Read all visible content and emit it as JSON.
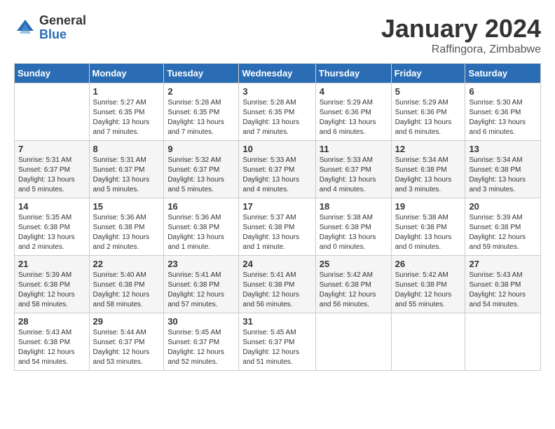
{
  "header": {
    "logo_general": "General",
    "logo_blue": "Blue",
    "month_title": "January 2024",
    "location": "Raffingora, Zimbabwe"
  },
  "days_of_week": [
    "Sunday",
    "Monday",
    "Tuesday",
    "Wednesday",
    "Thursday",
    "Friday",
    "Saturday"
  ],
  "weeks": [
    [
      {
        "day": "",
        "info": ""
      },
      {
        "day": "1",
        "info": "Sunrise: 5:27 AM\nSunset: 6:35 PM\nDaylight: 13 hours\nand 7 minutes."
      },
      {
        "day": "2",
        "info": "Sunrise: 5:28 AM\nSunset: 6:35 PM\nDaylight: 13 hours\nand 7 minutes."
      },
      {
        "day": "3",
        "info": "Sunrise: 5:28 AM\nSunset: 6:35 PM\nDaylight: 13 hours\nand 7 minutes."
      },
      {
        "day": "4",
        "info": "Sunrise: 5:29 AM\nSunset: 6:36 PM\nDaylight: 13 hours\nand 6 minutes."
      },
      {
        "day": "5",
        "info": "Sunrise: 5:29 AM\nSunset: 6:36 PM\nDaylight: 13 hours\nand 6 minutes."
      },
      {
        "day": "6",
        "info": "Sunrise: 5:30 AM\nSunset: 6:36 PM\nDaylight: 13 hours\nand 6 minutes."
      }
    ],
    [
      {
        "day": "7",
        "info": "Sunrise: 5:31 AM\nSunset: 6:37 PM\nDaylight: 13 hours\nand 5 minutes."
      },
      {
        "day": "8",
        "info": "Sunrise: 5:31 AM\nSunset: 6:37 PM\nDaylight: 13 hours\nand 5 minutes."
      },
      {
        "day": "9",
        "info": "Sunrise: 5:32 AM\nSunset: 6:37 PM\nDaylight: 13 hours\nand 5 minutes."
      },
      {
        "day": "10",
        "info": "Sunrise: 5:33 AM\nSunset: 6:37 PM\nDaylight: 13 hours\nand 4 minutes."
      },
      {
        "day": "11",
        "info": "Sunrise: 5:33 AM\nSunset: 6:37 PM\nDaylight: 13 hours\nand 4 minutes."
      },
      {
        "day": "12",
        "info": "Sunrise: 5:34 AM\nSunset: 6:38 PM\nDaylight: 13 hours\nand 3 minutes."
      },
      {
        "day": "13",
        "info": "Sunrise: 5:34 AM\nSunset: 6:38 PM\nDaylight: 13 hours\nand 3 minutes."
      }
    ],
    [
      {
        "day": "14",
        "info": "Sunrise: 5:35 AM\nSunset: 6:38 PM\nDaylight: 13 hours\nand 2 minutes."
      },
      {
        "day": "15",
        "info": "Sunrise: 5:36 AM\nSunset: 6:38 PM\nDaylight: 13 hours\nand 2 minutes."
      },
      {
        "day": "16",
        "info": "Sunrise: 5:36 AM\nSunset: 6:38 PM\nDaylight: 13 hours\nand 1 minute."
      },
      {
        "day": "17",
        "info": "Sunrise: 5:37 AM\nSunset: 6:38 PM\nDaylight: 13 hours\nand 1 minute."
      },
      {
        "day": "18",
        "info": "Sunrise: 5:38 AM\nSunset: 6:38 PM\nDaylight: 13 hours\nand 0 minutes."
      },
      {
        "day": "19",
        "info": "Sunrise: 5:38 AM\nSunset: 6:38 PM\nDaylight: 13 hours\nand 0 minutes."
      },
      {
        "day": "20",
        "info": "Sunrise: 5:39 AM\nSunset: 6:38 PM\nDaylight: 12 hours\nand 59 minutes."
      }
    ],
    [
      {
        "day": "21",
        "info": "Sunrise: 5:39 AM\nSunset: 6:38 PM\nDaylight: 12 hours\nand 58 minutes."
      },
      {
        "day": "22",
        "info": "Sunrise: 5:40 AM\nSunset: 6:38 PM\nDaylight: 12 hours\nand 58 minutes."
      },
      {
        "day": "23",
        "info": "Sunrise: 5:41 AM\nSunset: 6:38 PM\nDaylight: 12 hours\nand 57 minutes."
      },
      {
        "day": "24",
        "info": "Sunrise: 5:41 AM\nSunset: 6:38 PM\nDaylight: 12 hours\nand 56 minutes."
      },
      {
        "day": "25",
        "info": "Sunrise: 5:42 AM\nSunset: 6:38 PM\nDaylight: 12 hours\nand 56 minutes."
      },
      {
        "day": "26",
        "info": "Sunrise: 5:42 AM\nSunset: 6:38 PM\nDaylight: 12 hours\nand 55 minutes."
      },
      {
        "day": "27",
        "info": "Sunrise: 5:43 AM\nSunset: 6:38 PM\nDaylight: 12 hours\nand 54 minutes."
      }
    ],
    [
      {
        "day": "28",
        "info": "Sunrise: 5:43 AM\nSunset: 6:38 PM\nDaylight: 12 hours\nand 54 minutes."
      },
      {
        "day": "29",
        "info": "Sunrise: 5:44 AM\nSunset: 6:37 PM\nDaylight: 12 hours\nand 53 minutes."
      },
      {
        "day": "30",
        "info": "Sunrise: 5:45 AM\nSunset: 6:37 PM\nDaylight: 12 hours\nand 52 minutes."
      },
      {
        "day": "31",
        "info": "Sunrise: 5:45 AM\nSunset: 6:37 PM\nDaylight: 12 hours\nand 51 minutes."
      },
      {
        "day": "",
        "info": ""
      },
      {
        "day": "",
        "info": ""
      },
      {
        "day": "",
        "info": ""
      }
    ]
  ]
}
